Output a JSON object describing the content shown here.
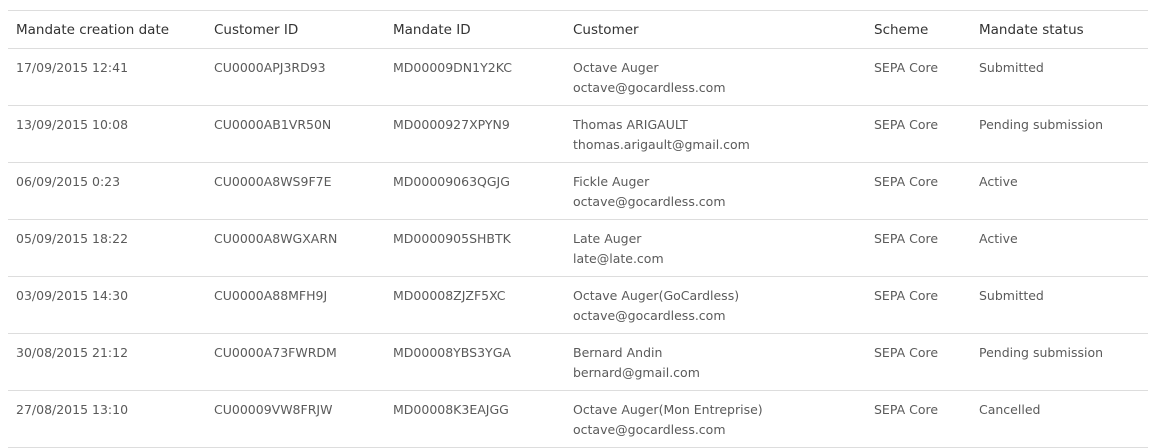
{
  "table": {
    "headers": [
      "Mandate creation date",
      "Customer ID",
      "Mandate ID",
      "Customer",
      "Scheme",
      "Mandate status"
    ],
    "rows": [
      {
        "date": "17/09/2015 12:41",
        "customer_id": "CU0000APJ3RD93",
        "mandate_id": "MD00009DN1Y2KC",
        "customer_name": "Octave Auger",
        "customer_email": "octave@gocardless.com",
        "scheme": "SEPA Core",
        "status": "Submitted"
      },
      {
        "date": "13/09/2015 10:08",
        "customer_id": "CU0000AB1VR50N",
        "mandate_id": "MD0000927XPYN9",
        "customer_name": "Thomas ARIGAULT",
        "customer_email": "thomas.arigault@gmail.com",
        "scheme": "SEPA Core",
        "status": "Pending submission"
      },
      {
        "date": "06/09/2015 0:23",
        "customer_id": "CU0000A8WS9F7E",
        "mandate_id": "MD00009063QGJG",
        "customer_name": "Fickle Auger",
        "customer_email": "octave@gocardless.com",
        "scheme": "SEPA Core",
        "status": "Active"
      },
      {
        "date": "05/09/2015 18:22",
        "customer_id": "CU0000A8WGXARN",
        "mandate_id": "MD0000905SHBTK",
        "customer_name": "Late Auger",
        "customer_email": "late@late.com",
        "scheme": "SEPA Core",
        "status": "Active"
      },
      {
        "date": "03/09/2015 14:30",
        "customer_id": "CU0000A88MFH9J",
        "mandate_id": "MD00008ZJZF5XC",
        "customer_name": "Octave Auger(GoCardless)",
        "customer_email": "octave@gocardless.com",
        "scheme": "SEPA Core",
        "status": "Submitted"
      },
      {
        "date": "30/08/2015 21:12",
        "customer_id": "CU0000A73FWRDM",
        "mandate_id": "MD00008YBS3YGA",
        "customer_name": "Bernard Andin",
        "customer_email": "bernard@gmail.com",
        "scheme": "SEPA Core",
        "status": "Pending submission"
      },
      {
        "date": "27/08/2015 13:10",
        "customer_id": "CU00009VW8FRJW",
        "mandate_id": "MD00008K3EAJGG",
        "customer_name": "Octave Auger(Mon Entreprise)",
        "customer_email": "octave@gocardless.com",
        "scheme": "SEPA Core",
        "status": "Cancelled"
      }
    ]
  }
}
